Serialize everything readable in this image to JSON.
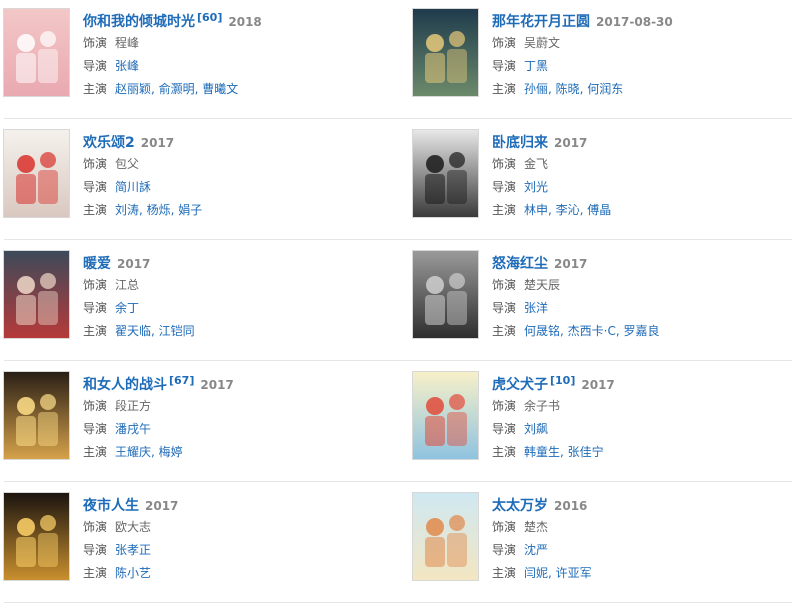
{
  "colors": {
    "link": "#1e6bb8",
    "year": "#888888",
    "label": "#555555",
    "separator": "#e6e6e6"
  },
  "labels": {
    "role": "饰演",
    "director": "导演",
    "cast": "主演"
  },
  "items": [
    {
      "title": "你和我的倾城时光",
      "badge": "[60]",
      "year": "2018",
      "role": "程峰",
      "director": "张峰",
      "cast": "赵丽颖, 俞灏明, 曹曦文",
      "poster": {
        "bg1": "#f3c7c7",
        "bg2": "#e9a9b0",
        "accent": "#ffffff"
      }
    },
    {
      "title": "那年花开月正圆",
      "badge": "",
      "year": "2017-08-30",
      "role": "吴蔚文",
      "director": "丁黑",
      "cast": "孙俪, 陈晓, 何润东",
      "poster": {
        "bg1": "#1f3b4d",
        "bg2": "#6b8a6a",
        "accent": "#e8c97a"
      }
    },
    {
      "title": "欢乐颂2",
      "badge": "",
      "year": "2017",
      "role": "包父",
      "director": "简川訸",
      "cast": "刘涛, 杨烁, 娟子",
      "poster": {
        "bg1": "#f4f1ec",
        "bg2": "#d9c8c0",
        "accent": "#d9302b"
      }
    },
    {
      "title": "卧底归来",
      "badge": "",
      "year": "2017",
      "role": "金飞",
      "director": "刘光",
      "cast": "林申, 李沁, 傅晶",
      "poster": {
        "bg1": "#e8e8e8",
        "bg2": "#3a3a3a",
        "accent": "#1a1a1a"
      }
    },
    {
      "title": "暖爱",
      "badge": "",
      "year": "2017",
      "role": "江总",
      "director": "余丁",
      "cast": "翟天临, 江铠同",
      "poster": {
        "bg1": "#3d4a5a",
        "bg2": "#b63a3a",
        "accent": "#f0d8c8"
      }
    },
    {
      "title": "怒海红尘",
      "badge": "",
      "year": "2017",
      "role": "楚天辰",
      "director": "张洋",
      "cast": "何晟铭, 杰西卡·C, 罗嘉良",
      "poster": {
        "bg1": "#9a9a9a",
        "bg2": "#2e2e2e",
        "accent": "#cfcfcf"
      }
    },
    {
      "title": "和女人的战斗",
      "badge": "[67]",
      "year": "2017",
      "role": "段正方",
      "director": "潘戌午",
      "cast": "王耀庆, 梅婷",
      "poster": {
        "bg1": "#2a1f16",
        "bg2": "#d6a24a",
        "accent": "#ffe08a"
      }
    },
    {
      "title": "虎父犬子",
      "badge": "[10]",
      "year": "2017",
      "role": "余子书",
      "director": "刘飙",
      "cast": "韩童生, 张佳宁",
      "poster": {
        "bg1": "#f7f0c8",
        "bg2": "#8fc3e0",
        "accent": "#e24a3a"
      }
    },
    {
      "title": "夜市人生",
      "badge": "",
      "year": "2017",
      "role": "欧大志",
      "director": "张孝正",
      "cast": "陈小艺",
      "poster": {
        "bg1": "#1b1410",
        "bg2": "#c9902e",
        "accent": "#ffd36a"
      }
    },
    {
      "title": "太太万岁",
      "badge": "",
      "year": "2016",
      "role": "楚杰",
      "director": "沈严",
      "cast": "闫妮, 许亚军",
      "poster": {
        "bg1": "#cfe8f2",
        "bg2": "#f3e6c2",
        "accent": "#e0884a"
      }
    }
  ]
}
